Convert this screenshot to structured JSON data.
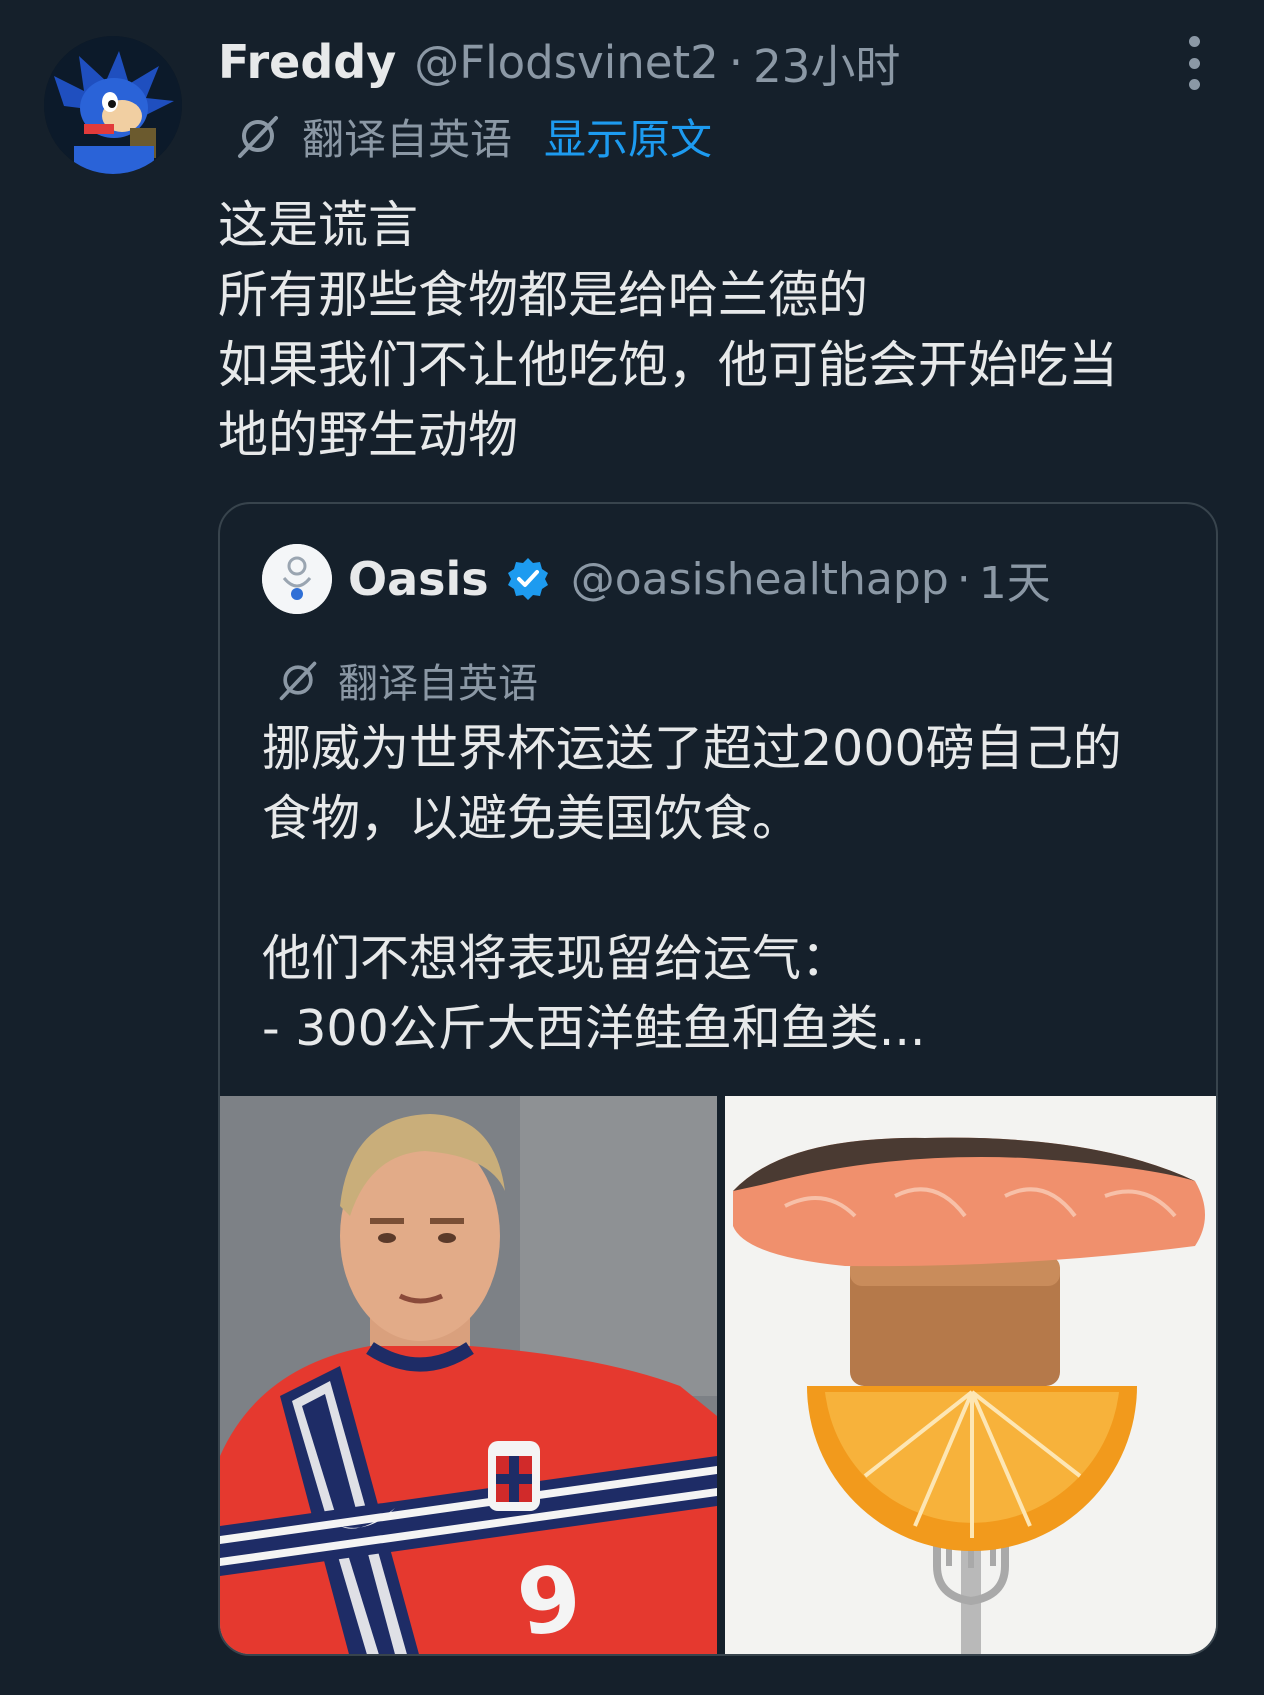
{
  "tweet": {
    "author_name": "Freddy",
    "handle": "@Flodsvinet2",
    "separator": "·",
    "time": "23小时",
    "translated_label": "翻译自英语",
    "show_original": "显示原文",
    "text_lines": [
      "这是谎言",
      "所有那些食物都是给哈兰德的",
      "如果我们不让他吃饱，他可能会开始吃当",
      "地的野生动物"
    ]
  },
  "quote": {
    "author_name": "Oasis",
    "handle": "@oasishealthapp",
    "separator": "·",
    "time": "1天",
    "translated_label": "翻译自英语",
    "text_lines": [
      "挪威为世界杯运送了超过2000磅自己的",
      "食物，以避免美国饮食。",
      "",
      "他们不想将表现留给运气：",
      "- 300公斤大西洋鲑鱼和鱼类..."
    ],
    "media": [
      {
        "subject": "footballer-in-norway-kit",
        "jersey_number": "9"
      },
      {
        "subject": "salmon-brown-cheese-orange-on-fork"
      }
    ]
  },
  "icons": {
    "more": "more-vertical-icon",
    "translate": "translate-icon",
    "verified": "verified-badge-icon"
  },
  "colors": {
    "background": "#15202b",
    "text": "#e7e9ea",
    "secondary": "#8b98a5",
    "link": "#1d9bf0",
    "verified": "#1d9bf0",
    "border": "#38444d"
  }
}
